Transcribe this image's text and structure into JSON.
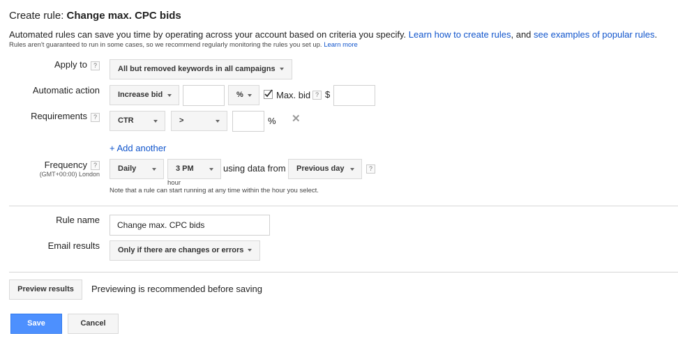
{
  "header": {
    "title_prefix": "Create rule: ",
    "title_name": "Change max. CPC bids",
    "description": "Automated rules can save you time by operating across your account based on criteria you specify. ",
    "learn_link": "Learn how to create rules",
    "description_mid": ", and ",
    "examples_link": "see examples of popular rules",
    "description_end": ".",
    "note": "Rules aren't guaranteed to run in some cases, so we recommend regularly monitoring the rules you set up. ",
    "learn_more": "Learn more"
  },
  "help_glyph": "?",
  "apply_to": {
    "label": "Apply to",
    "value": "All but removed keywords in all campaigns"
  },
  "action": {
    "label": "Automatic action",
    "type": "Increase bid",
    "amount": "",
    "unit": "%",
    "max_bid_checked": true,
    "max_bid_label": "Max. bid",
    "currency": "$",
    "max_bid_value": ""
  },
  "requirements": {
    "label": "Requirements",
    "metric": "CTR",
    "operator": ">",
    "value": "",
    "unit": "%",
    "remove_glyph": "✕",
    "add_another": "+ Add another"
  },
  "frequency": {
    "label": "Frequency",
    "timezone": "(GMT+00:00) London",
    "period": "Daily",
    "hour": "3 PM",
    "hour_caption": "hour",
    "using_label": "using data from",
    "data_range": "Previous day",
    "note": "Note that a rule can start running at any time within the hour you select."
  },
  "rule_name": {
    "label": "Rule name",
    "value": "Change max. CPC bids"
  },
  "email": {
    "label": "Email results",
    "value": "Only if there are changes or errors"
  },
  "preview": {
    "button": "Preview results",
    "hint": "Previewing is recommended before saving"
  },
  "footer": {
    "save": "Save",
    "cancel": "Cancel"
  }
}
